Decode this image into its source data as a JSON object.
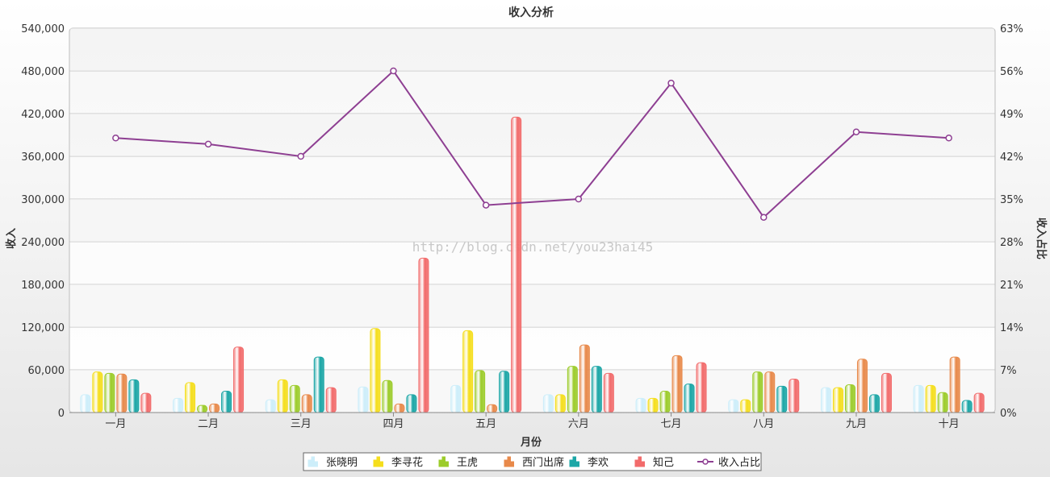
{
  "chart_data": {
    "type": "bar",
    "title": "收入分析",
    "xlabel": "月份",
    "ylabel": "收入",
    "y2label": "收入占比",
    "categories": [
      "一月",
      "二月",
      "三月",
      "四月",
      "五月",
      "六月",
      "七月",
      "八月",
      "九月",
      "十月"
    ],
    "ylim": [
      0,
      540000
    ],
    "y_ticks": [
      "0",
      "60,000",
      "120,000",
      "180,000",
      "240,000",
      "300,000",
      "360,000",
      "420,000",
      "480,000",
      "540,000"
    ],
    "y2lim": [
      0,
      63
    ],
    "y2_ticks": [
      "0%",
      "7%",
      "14%",
      "21%",
      "28%",
      "35%",
      "42%",
      "49%",
      "56%",
      "63%"
    ],
    "series": [
      {
        "name": "张晓明",
        "type": "bar",
        "color": "#cdeefa",
        "values": [
          25000,
          20000,
          18000,
          36000,
          38000,
          25000,
          20000,
          18000,
          35000,
          38000
        ]
      },
      {
        "name": "李寻花",
        "type": "bar",
        "color": "#f5de1c",
        "values": [
          57000,
          42000,
          46000,
          118000,
          115000,
          25000,
          20000,
          18000,
          35000,
          38000
        ]
      },
      {
        "name": "王虎",
        "type": "bar",
        "color": "#9ccc2a",
        "values": [
          55000,
          10000,
          38000,
          45000,
          59000,
          65000,
          30000,
          57000,
          39000,
          28000
        ]
      },
      {
        "name": "西门出席",
        "type": "bar",
        "color": "#e8894a",
        "values": [
          54000,
          12000,
          25000,
          12000,
          11000,
          95000,
          80000,
          57000,
          75000,
          78000
        ]
      },
      {
        "name": "李欢",
        "type": "bar",
        "color": "#1ba6a6",
        "values": [
          46000,
          30000,
          78000,
          25000,
          58000,
          65000,
          40000,
          37000,
          25000,
          17000
        ]
      },
      {
        "name": "知己",
        "type": "bar",
        "color": "#f26b6b",
        "values": [
          27000,
          92000,
          35000,
          217000,
          415000,
          55000,
          70000,
          47000,
          55000,
          27000
        ]
      },
      {
        "name": "收入占比",
        "type": "line",
        "axis": "y2",
        "color": "#8e3f92",
        "values": [
          45,
          44,
          42,
          56,
          34,
          35,
          54,
          32,
          46,
          45
        ]
      }
    ],
    "grid": true,
    "legend_position": "bottom",
    "watermark": "http://blog.csdn.net/you23hai45"
  }
}
